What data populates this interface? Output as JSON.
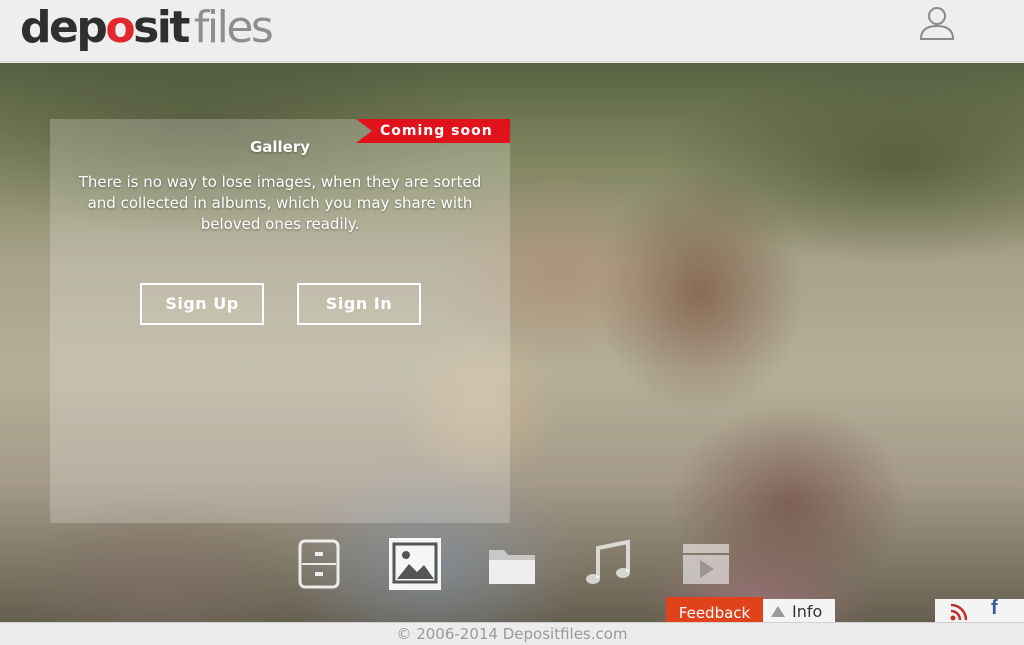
{
  "header": {
    "logo": {
      "part1": "dep",
      "part2": "o",
      "part3": "sit",
      "part4": "files"
    },
    "user_icon": "user-icon"
  },
  "hero": {
    "ribbon": "Coming soon",
    "title": "Gallery",
    "description": "There is no way to lose images, when they are sorted and collected in albums, which you may share with beloved ones readily.",
    "signup_label": "Sign Up",
    "signin_label": "Sign In",
    "categories": [
      {
        "icon": "archive-icon",
        "active": false
      },
      {
        "icon": "image-icon",
        "active": true
      },
      {
        "icon": "folder-icon",
        "active": false
      },
      {
        "icon": "music-icon",
        "active": false
      },
      {
        "icon": "video-icon",
        "active": false
      }
    ]
  },
  "footer": {
    "copyright": "© 2006-2014 Depositfiles.com",
    "feedback": "Feedback",
    "info": "Info",
    "rss_icon": "rss-icon",
    "facebook": "f"
  },
  "colors": {
    "brand_red": "#e0282e",
    "ribbon_red": "#e0121b",
    "feedback_orange": "#e0421c",
    "facebook_blue": "#3b5998"
  }
}
